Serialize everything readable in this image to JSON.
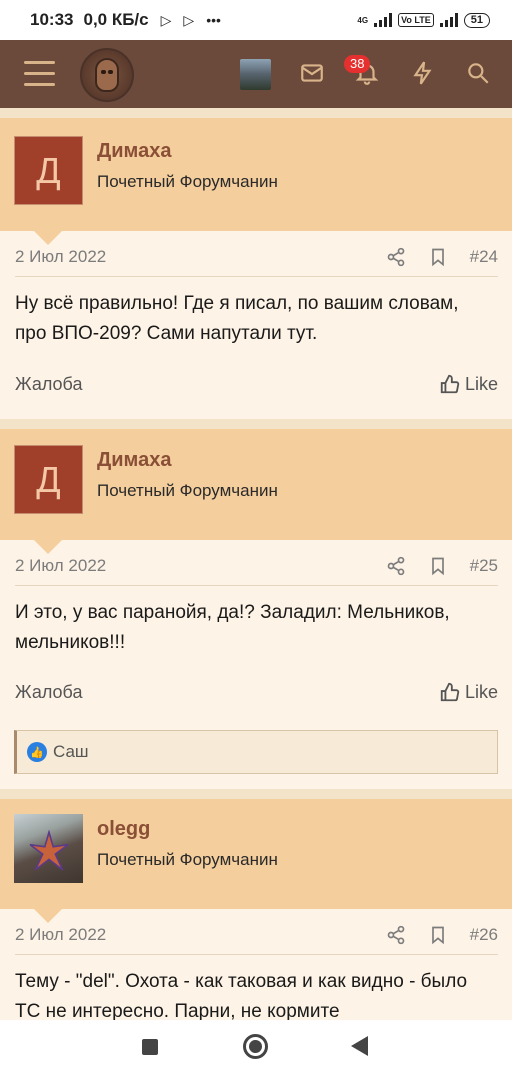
{
  "status_bar": {
    "time": "10:33",
    "speed": "0,0 КБ/с",
    "net_label": "4G",
    "lte_label": "Vo LTE",
    "battery": "51"
  },
  "nav": {
    "notifications_badge": "38",
    "accent": "#6b4a3c",
    "icon_color": "#d9b48a"
  },
  "posts": [
    {
      "avatar_letter": "Д",
      "username": "Димаха",
      "user_title": "Почетный Форумчанин",
      "date": "2 Июл 2022",
      "number": "#24",
      "content": "Ну всё правильно! Где я писал, по вашим словам, про ВПО-209? Сами напутали тут.",
      "report_label": "Жалоба",
      "like_label": "Like"
    },
    {
      "avatar_letter": "Д",
      "username": "Димаха",
      "user_title": "Почетный Форумчанин",
      "date": "2 Июл 2022",
      "number": "#25",
      "content": "И это, у вас паранойя, да!? Заладил: Мельников, мельников!!!",
      "report_label": "Жалоба",
      "like_label": "Like",
      "reaction_user": "Саш"
    },
    {
      "username": "olegg",
      "user_title": "Почетный Форумчанин",
      "date": "2 Июл 2022",
      "number": "#26",
      "content": "Тему - \"del\". Охота - как таковая и как видно - было ТС не интересно. Парни, не кормите"
    }
  ]
}
